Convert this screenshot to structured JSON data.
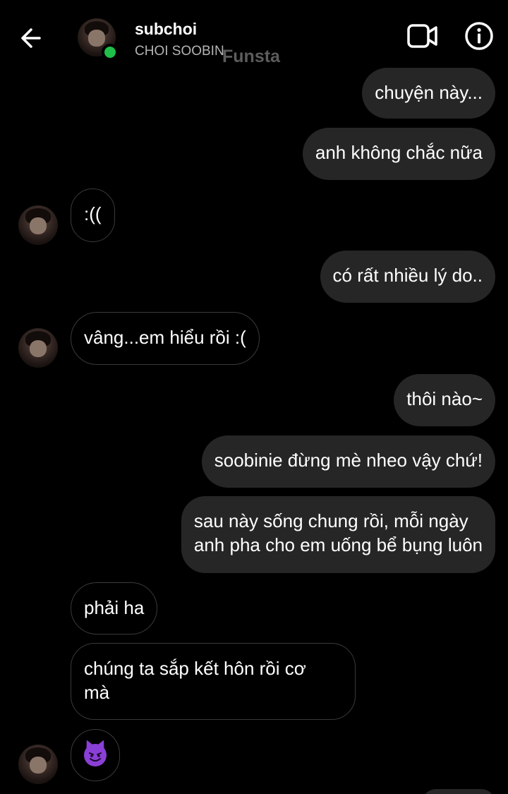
{
  "header": {
    "username": "subchoi",
    "subtitle": "CHOI SOOBIN",
    "watermark": "Funsta"
  },
  "colors": {
    "background": "#000000",
    "sent_bubble": "#262626",
    "received_border": "#3a3a3a",
    "online": "#1fbf4a",
    "subtitle": "#b4b4b4"
  },
  "messages": [
    {
      "from": "me",
      "text": "chuyện này..."
    },
    {
      "from": "me",
      "text": "anh không chắc nữa"
    },
    {
      "from": "them",
      "text": ":(("
    },
    {
      "from": "me",
      "text": "có rất nhiều lý do.."
    },
    {
      "from": "them",
      "text": "vâng...em hiểu rồi :("
    },
    {
      "from": "me",
      "text": "thôi nào~"
    },
    {
      "from": "me",
      "text": "soobinie đừng mè nheo vậy chứ!"
    },
    {
      "from": "me",
      "line1": "sau này sống chung rồi, mỗi ngày",
      "line2": "anh pha cho em uống bể bụng luôn"
    },
    {
      "from": "them",
      "text": "phải ha"
    },
    {
      "from": "them",
      "line1": "chúng ta sắp kết hôn rồi cơ",
      "line2": "mà"
    },
    {
      "from": "them",
      "emoji": "smiling-face-with-horns"
    }
  ]
}
